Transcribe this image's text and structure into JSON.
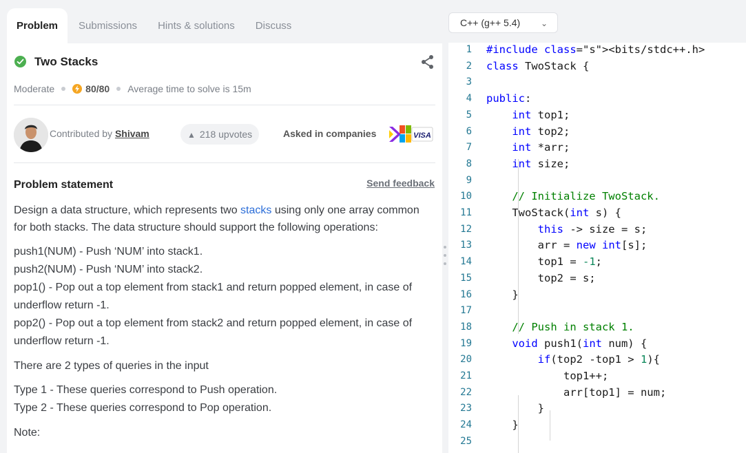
{
  "tabs": [
    {
      "label": "Problem",
      "active": true
    },
    {
      "label": "Submissions",
      "active": false
    },
    {
      "label": "Hints & solutions",
      "active": false
    },
    {
      "label": "Discuss",
      "active": false
    }
  ],
  "problem": {
    "title": "Two Stacks",
    "difficulty": "Moderate",
    "score": "80/80",
    "avg_time": "Average time to solve is 15m",
    "contributed_prefix": "Contributed by",
    "author": "Shivam",
    "upvotes": "218 upvotes",
    "asked_in": "Asked in companies",
    "statement_heading": "Problem statement",
    "send_feedback": "Send feedback",
    "para1_before": "Design a data structure, which represents two ",
    "para1_link": "stacks",
    "para1_after": " using only one array common for both stacks. The data structure should support the following operations:",
    "ops": [
      "push1(NUM) - Push ‘NUM’ into stack1.",
      "push2(NUM) - Push ‘NUM’ into stack2.",
      "pop1() - Pop out a top element from stack1 and return popped element, in case of underflow return -1.",
      "pop2() - Pop out a top element from stack2 and return popped element, in case of underflow return -1."
    ],
    "queries_intro": "There are 2 types of queries in the input",
    "types": [
      "Type 1 - These queries correspond to Push operation.",
      "Type 2 - These queries correspond to Pop operation."
    ],
    "note": "Note:"
  },
  "editor": {
    "language": "C++ (g++ 5.4)",
    "line_numbers": [
      "1",
      "2",
      "3",
      "4",
      "5",
      "6",
      "7",
      "8",
      "9",
      "10",
      "11",
      "12",
      "13",
      "14",
      "15",
      "16",
      "17",
      "18",
      "19",
      "20",
      "21",
      "22",
      "23",
      "24",
      "25"
    ],
    "lines": [
      "#include <bits/stdc++.h>",
      "class TwoStack {",
      "",
      "public:",
      "    int top1;",
      "    int top2;",
      "    int *arr;",
      "    int size;",
      "",
      "    // Initialize TwoStack.",
      "    TwoStack(int s) {",
      "        this -> size = s;",
      "        arr = new int[s];",
      "        top1 = -1;",
      "        top2 = s;",
      "    }",
      "",
      "    // Push in stack 1.",
      "    void push1(int num) {",
      "        if(top2 -top1 > 1){",
      "            top1++;",
      "            arr[top1] = num;",
      "        }",
      "    }",
      ""
    ]
  },
  "colors": {
    "accent_link": "#2b6dd8",
    "success": "#4caf50",
    "score_bolt": "#f5a623",
    "keyword": "#0000ff",
    "comment": "#008000",
    "line_number": "#237893"
  }
}
